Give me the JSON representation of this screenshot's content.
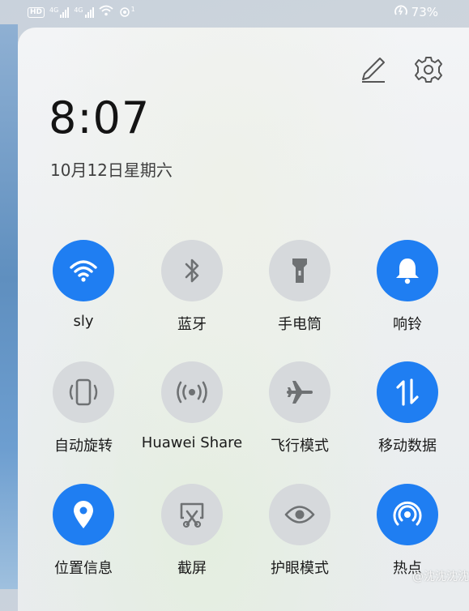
{
  "status_bar": {
    "hd_badge": "HD",
    "signal1_label": "4G",
    "signal2_label": "4G",
    "nfc_badge": "1",
    "battery_percent": "73%"
  },
  "header": {
    "edit_icon": "pencil-icon",
    "settings_icon": "gear-icon",
    "time": "8:07",
    "date": "10月12日星期六"
  },
  "tiles": [
    {
      "label": "sly",
      "icon": "wifi-icon",
      "active": true
    },
    {
      "label": "蓝牙",
      "icon": "bluetooth-icon",
      "active": false
    },
    {
      "label": "手电筒",
      "icon": "flashlight-icon",
      "active": false
    },
    {
      "label": "响铃",
      "icon": "bell-icon",
      "active": true
    },
    {
      "label": "自动旋转",
      "icon": "auto-rotate-icon",
      "active": false
    },
    {
      "label": "Huawei Share",
      "icon": "huawei-share-icon",
      "active": false
    },
    {
      "label": "飞行模式",
      "icon": "airplane-icon",
      "active": false
    },
    {
      "label": "移动数据",
      "icon": "mobile-data-icon",
      "active": true
    },
    {
      "label": "位置信息",
      "icon": "location-icon",
      "active": true
    },
    {
      "label": "截屏",
      "icon": "screenshot-icon",
      "active": false
    },
    {
      "label": "护眼模式",
      "icon": "eye-icon",
      "active": false
    },
    {
      "label": "热点",
      "icon": "hotspot-icon",
      "active": true
    }
  ],
  "watermark": "@沈沈沈沈",
  "colors": {
    "active": "#1f7ef2",
    "inactive": "#d6d9dc",
    "inactive_icon": "#6e7173"
  }
}
